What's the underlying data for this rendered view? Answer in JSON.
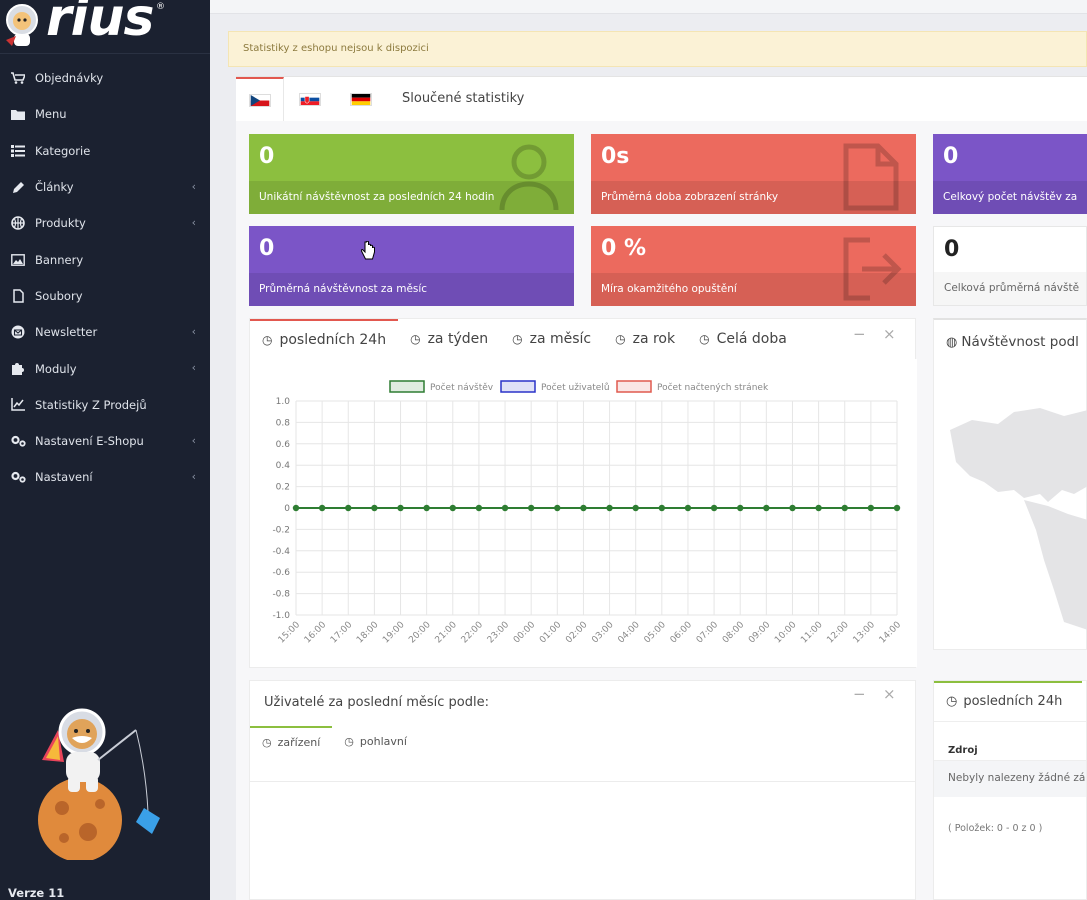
{
  "sidebar": {
    "brand": "rius",
    "brand_mark": "®",
    "items": [
      {
        "label": "Objednávky",
        "icon": "cart-icon",
        "chevron": false
      },
      {
        "label": "Menu",
        "icon": "folder-icon",
        "chevron": false
      },
      {
        "label": "Kategorie",
        "icon": "list-icon",
        "chevron": false
      },
      {
        "label": "Články",
        "icon": "pencil-icon",
        "chevron": true
      },
      {
        "label": "Produkty",
        "icon": "basketball-icon",
        "chevron": true
      },
      {
        "label": "Bannery",
        "icon": "image-icon",
        "chevron": false
      },
      {
        "label": "Soubory",
        "icon": "file-icon",
        "chevron": false
      },
      {
        "label": "Newsletter",
        "icon": "envelope-icon",
        "chevron": true
      },
      {
        "label": "Moduly",
        "icon": "puzzle-icon",
        "chevron": true
      },
      {
        "label": "Statistiky Z Prodejů",
        "icon": "line-chart-icon",
        "chevron": false
      },
      {
        "label": "Nastavení E-Shopu",
        "icon": "gears-icon",
        "chevron": true
      },
      {
        "label": "Nastavení",
        "icon": "gears-icon",
        "chevron": true
      }
    ],
    "version": "Verze 11"
  },
  "alert": "Statistiky z eshopu nejsou k dispozici",
  "lang_tabs": {
    "flags": [
      "cz-flag",
      "sk-flag",
      "de-flag"
    ],
    "merged_label": "Sloučené statistiky"
  },
  "tiles": [
    {
      "value": "0",
      "label": "Unikátní návštěvnost za posledních 24 hodin",
      "color": "#8cbf3f"
    },
    {
      "value": "0s",
      "label": "Průměrná doba zobrazení stránky",
      "color": "#ec6a5e"
    },
    {
      "value": "0",
      "label": "Celkový počet návštěv za",
      "color": "#7b55c7"
    },
    {
      "value": "0",
      "label": "Průměrná návštěvnost za měsíc",
      "color": "#7b55c7"
    },
    {
      "value": "0 %",
      "label": "Míra okamžitého opuštění",
      "color": "#ec6a5e"
    },
    {
      "value": "0",
      "label": "Celková průměrná návště",
      "color": "#ffffff"
    }
  ],
  "chart_panel": {
    "tabs": [
      "posledních 24h",
      "za týden",
      "za měsíc",
      "za rok",
      "Celá doba"
    ],
    "minimize": "−",
    "close": "×"
  },
  "chart_data": {
    "type": "line",
    "x": [
      "15:00",
      "16:00",
      "17:00",
      "18:00",
      "19:00",
      "20:00",
      "21:00",
      "22:00",
      "23:00",
      "00:00",
      "01:00",
      "02:00",
      "03:00",
      "04:00",
      "05:00",
      "06:00",
      "07:00",
      "08:00",
      "09:00",
      "10:00",
      "11:00",
      "12:00",
      "13:00",
      "14:00"
    ],
    "series": [
      {
        "name": "Počet návštěv",
        "color": "#2e7d32",
        "values": [
          0,
          0,
          0,
          0,
          0,
          0,
          0,
          0,
          0,
          0,
          0,
          0,
          0,
          0,
          0,
          0,
          0,
          0,
          0,
          0,
          0,
          0,
          0,
          0
        ]
      },
      {
        "name": "Počet uživatelů",
        "color": "#2a33c9",
        "values": [
          0,
          0,
          0,
          0,
          0,
          0,
          0,
          0,
          0,
          0,
          0,
          0,
          0,
          0,
          0,
          0,
          0,
          0,
          0,
          0,
          0,
          0,
          0,
          0
        ]
      },
      {
        "name": "Počet načtených stránek",
        "color": "#e05a4f",
        "values": [
          0,
          0,
          0,
          0,
          0,
          0,
          0,
          0,
          0,
          0,
          0,
          0,
          0,
          0,
          0,
          0,
          0,
          0,
          0,
          0,
          0,
          0,
          0,
          0
        ]
      }
    ],
    "yticks": [
      "1.0",
      "0.8",
      "0.6",
      "0.4",
      "0.2",
      "0",
      "-0.2",
      "-0.4",
      "-0.6",
      "-0.8",
      "-1.0"
    ],
    "ylim": [
      -1.0,
      1.0
    ],
    "grid": true,
    "legend": "top-center"
  },
  "map_panel": {
    "title": "Návštěvnost podl"
  },
  "users_panel": {
    "title": "Uživatelé za poslední měsíc podle:",
    "subtabs": [
      "zařízení",
      "pohlavní"
    ],
    "minimize": "−",
    "close": "×"
  },
  "source_panel": {
    "tab": "posledních 24h",
    "column": "Zdroj",
    "empty": "Nebyly nalezeny žádné zá",
    "pager": "( Položek: 0 - 0 z 0 )"
  }
}
